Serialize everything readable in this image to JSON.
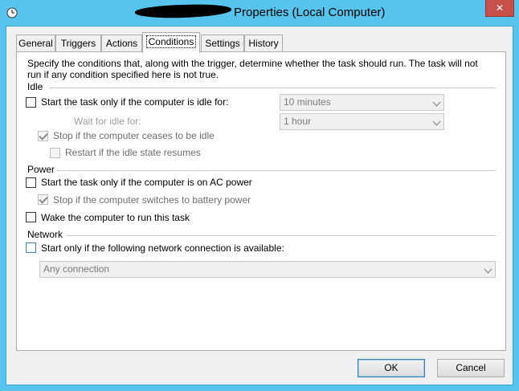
{
  "window": {
    "title": "Properties (Local Computer)",
    "close_label": "✕"
  },
  "tabs": [
    {
      "label": "General"
    },
    {
      "label": "Triggers"
    },
    {
      "label": "Actions"
    },
    {
      "label": "Conditions",
      "active": true
    },
    {
      "label": "Settings"
    },
    {
      "label": "History"
    }
  ],
  "description": {
    "line1": "Specify the conditions that, along with the trigger, determine whether the task should run.  The task will not",
    "line2": "run  if any condition specified here is not true."
  },
  "idle": {
    "header": "Idle",
    "start_if_idle": {
      "label": "Start the task only if the computer is idle for:",
      "checked": false
    },
    "idle_duration": {
      "value": "10 minutes"
    },
    "wait_label": "Wait for idle for:",
    "wait_duration": {
      "value": "1 hour"
    },
    "stop_if_ceases": {
      "label": "Stop if the computer ceases to be idle",
      "checked": true
    },
    "restart_if_resumes": {
      "label": "Restart if the idle state resumes",
      "checked": false
    }
  },
  "power": {
    "header": "Power",
    "start_on_ac": {
      "label": "Start the task only if the computer is on AC power",
      "checked": false
    },
    "stop_on_battery": {
      "label": "Stop if the computer switches to battery power",
      "checked": true
    },
    "wake_to_run": {
      "label": "Wake the computer to run this task",
      "checked": false
    }
  },
  "network": {
    "header": "Network",
    "start_if_network": {
      "label": "Start only if the following network connection is available:",
      "checked": false
    },
    "connection": {
      "value": "Any connection"
    }
  },
  "buttons": {
    "ok": "OK",
    "cancel": "Cancel"
  }
}
